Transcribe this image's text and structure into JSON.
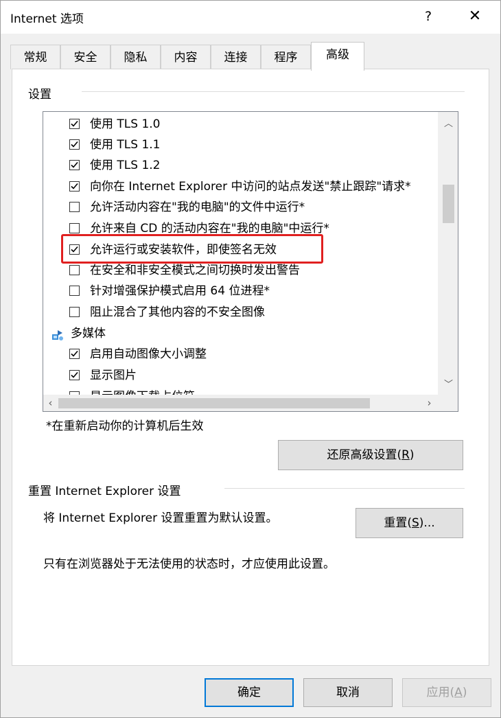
{
  "window": {
    "title": "Internet 选项",
    "help_glyph": "?",
    "close_glyph": "✕"
  },
  "tabs": [
    {
      "label": "常规",
      "active": false
    },
    {
      "label": "安全",
      "active": false
    },
    {
      "label": "隐私",
      "active": false
    },
    {
      "label": "内容",
      "active": false
    },
    {
      "label": "连接",
      "active": false
    },
    {
      "label": "程序",
      "active": false
    },
    {
      "label": "高级",
      "active": true
    }
  ],
  "settings": {
    "group_label": "设置",
    "items": [
      {
        "type": "checkbox",
        "checked": true,
        "label": "使用 TLS 1.0"
      },
      {
        "type": "checkbox",
        "checked": true,
        "label": "使用 TLS 1.1"
      },
      {
        "type": "checkbox",
        "checked": true,
        "label": "使用 TLS 1.2"
      },
      {
        "type": "checkbox",
        "checked": true,
        "label": "向你在 Internet Explorer 中访问的站点发送\"禁止跟踪\"请求*"
      },
      {
        "type": "checkbox",
        "checked": false,
        "label": "允许活动内容在\"我的电脑\"的文件中运行*"
      },
      {
        "type": "checkbox",
        "checked": false,
        "label": "允许来自 CD 的活动内容在\"我的电脑\"中运行*"
      },
      {
        "type": "checkbox",
        "checked": true,
        "label": "允许运行或安装软件，即使签名无效",
        "highlighted": true
      },
      {
        "type": "checkbox",
        "checked": false,
        "label": "在安全和非安全模式之间切换时发出警告"
      },
      {
        "type": "checkbox",
        "checked": false,
        "label": "针对增强保护模式启用 64 位进程*"
      },
      {
        "type": "checkbox",
        "checked": false,
        "label": "阻止混合了其他内容的不安全图像"
      },
      {
        "type": "category",
        "label": "多媒体",
        "icon": "multimedia-icon"
      },
      {
        "type": "checkbox",
        "checked": true,
        "label": "启用自动图像大小调整"
      },
      {
        "type": "checkbox",
        "checked": true,
        "label": "显示图片"
      },
      {
        "type": "checkbox",
        "checked": false,
        "label": "显示图像下载占位符"
      }
    ],
    "restart_note": "*在重新启动你的计算机后生效",
    "restore_button": "还原高级设置",
    "restore_mnemonic": "R"
  },
  "reset": {
    "group_label": "重置 Internet Explorer 设置",
    "description": "将 Internet Explorer 设置重置为默认设置。",
    "button": "重置",
    "mnemonic": "S",
    "button_suffix": "...",
    "note": "只有在浏览器处于无法使用的状态时，才应使用此设置。"
  },
  "footer": {
    "ok": "确定",
    "cancel": "取消",
    "apply": "应用",
    "apply_mnemonic": "A"
  },
  "colors": {
    "highlight_border": "#e02020",
    "default_button_border": "#0078d7"
  }
}
